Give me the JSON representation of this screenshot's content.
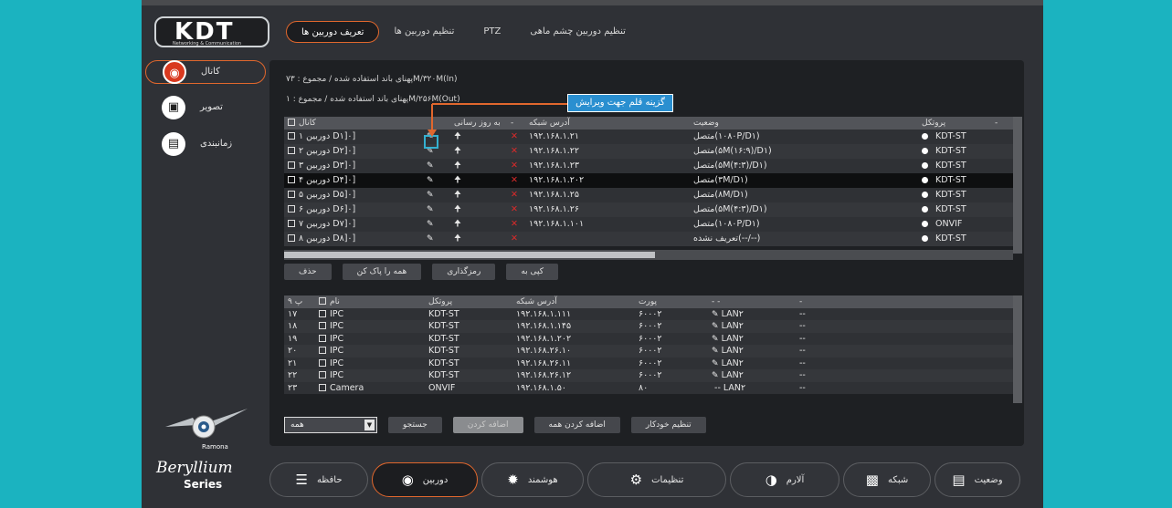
{
  "logo": {
    "title": "KDT",
    "subtitle": "Networking & Communication"
  },
  "tabs": [
    "تعریف دوربین ها",
    "تنظیم دوربین ها",
    "PTZ",
    "تنظیم دوربین چشم ماهی"
  ],
  "sidebar": [
    {
      "label": "کانال",
      "icon": "camera-icon"
    },
    {
      "label": "تصویر",
      "icon": "image-icon"
    },
    {
      "label": "زمانبندی",
      "icon": "calendar-icon"
    }
  ],
  "bandwidth": {
    "in": "پهنای باند استفاده شده / مجموع : ۷۳M/۳۲۰M(In)",
    "out": "پهنای باند استفاده شده / مجموع : ۱M/۲۵۶M(Out)"
  },
  "annotation": "گزینه قلم جهت ویرایش",
  "table1": {
    "headers": [
      "کانال",
      "",
      "به روز رسانی",
      "-",
      "آدرس شبکه",
      "وضعیت",
      "پروتکل",
      "-"
    ],
    "rows": [
      {
        "channel": "دوربین ۱ D۱]۰]",
        "ip": "۱۹۲.۱۶۸.۱.۲۱",
        "status": "متصل(۱۰۸۰P/D۱)",
        "protocol": "KDT-ST"
      },
      {
        "channel": "دوربین ۲ D۲]۰]",
        "ip": "۱۹۲.۱۶۸.۱.۲۲",
        "status": "متصل(۵M(۱۶:۹)/D۱)",
        "protocol": "KDT-ST"
      },
      {
        "channel": "دوربین ۳ D۳]۰]",
        "ip": "۱۹۲.۱۶۸.۱.۲۳",
        "status": "متصل(۵M(۴:۳)/D۱)",
        "protocol": "KDT-ST"
      },
      {
        "channel": "دوربین ۴ D۴]۰]",
        "ip": "۱۹۲.۱۶۸.۱.۲۰۲",
        "status": "متصل(۳M/D۱)",
        "protocol": "KDT-ST"
      },
      {
        "channel": "دوربین ۵ D۵]۰]",
        "ip": "۱۹۲.۱۶۸.۱.۲۵",
        "status": "متصل(۸M/D۱)",
        "protocol": "KDT-ST"
      },
      {
        "channel": "دوربین ۶ D۶]۰]",
        "ip": "۱۹۲.۱۶۸.۱.۲۶",
        "status": "متصل(۵M(۴:۳)/D۱)",
        "protocol": "KDT-ST"
      },
      {
        "channel": "دوربین ۷ D۷]۰]",
        "ip": "۱۹۲.۱۶۸.۱.۱۰۱",
        "status": "متصل(۱۰۸۰P/D۱)",
        "protocol": "ONVIF"
      },
      {
        "channel": "دوربین ۸ D۸]۰]",
        "ip": "",
        "status": "تعریف نشده(--/--)",
        "protocol": "KDT-ST"
      }
    ]
  },
  "actions1": [
    "حذف",
    "همه را پاک کن",
    "رمزگذاری",
    "کپی به"
  ],
  "table2": {
    "headers": [
      "پ ۹",
      "نام",
      "پروتکل",
      "آدرس شبکه",
      "پورت",
      "- -",
      "-"
    ],
    "rows": [
      {
        "no": "۱۷",
        "name": "IPC",
        "protocol": "KDT-ST",
        "ip": "۱۹۲.۱۶۸.۱.۱۱۱",
        "port": "۶۰۰۰۲",
        "lan": "LAN۲",
        "extra": "--"
      },
      {
        "no": "۱۸",
        "name": "IPC",
        "protocol": "KDT-ST",
        "ip": "۱۹۲.۱۶۸.۱.۱۴۵",
        "port": "۶۰۰۰۲",
        "lan": "LAN۲",
        "extra": "--"
      },
      {
        "no": "۱۹",
        "name": "IPC",
        "protocol": "KDT-ST",
        "ip": "۱۹۲.۱۶۸.۱.۲۰۲",
        "port": "۶۰۰۰۲",
        "lan": "LAN۲",
        "extra": "--"
      },
      {
        "no": "۲۰",
        "name": "IPC",
        "protocol": "KDT-ST",
        "ip": "۱۹۲.۱۶۸.۲۶.۱۰",
        "port": "۶۰۰۰۲",
        "lan": "LAN۲",
        "extra": "--"
      },
      {
        "no": "۲۱",
        "name": "IPC",
        "protocol": "KDT-ST",
        "ip": "۱۹۲.۱۶۸.۲۶.۱۱",
        "port": "۶۰۰۰۲",
        "lan": "LAN۲",
        "extra": "--"
      },
      {
        "no": "۲۲",
        "name": "IPC",
        "protocol": "KDT-ST",
        "ip": "۱۹۲.۱۶۸.۲۶.۱۲",
        "port": "۶۰۰۰۲",
        "lan": "LAN۲",
        "extra": "--"
      },
      {
        "no": "۲۳",
        "name": "Camera",
        "protocol": "ONVIF",
        "ip": "۱۹۲.۱۶۸.۱.۵۰",
        "port": "۸۰",
        "lan": "LAN۲",
        "extra": "--"
      }
    ]
  },
  "filter": {
    "selected": "همه"
  },
  "actions2": [
    "جستجو",
    "اضافه کردن",
    "اضافه کردن همه",
    "تنظیم خودکار"
  ],
  "brand": {
    "robot": "Ramona",
    "name": "Beryllium",
    "series": "Series"
  },
  "nav": [
    {
      "label": "حافظه",
      "icon": "storage-icon"
    },
    {
      "label": "دوربین",
      "icon": "camera-icon"
    },
    {
      "label": "هوشمند",
      "icon": "smart-icon"
    },
    {
      "label": "تنظیمات",
      "icon": "settings-icon"
    },
    {
      "label": "آلارم",
      "icon": "alarm-icon"
    },
    {
      "label": "شبکه",
      "icon": "network-icon"
    },
    {
      "label": "وضعیت",
      "icon": "status-icon"
    }
  ],
  "colors": {
    "accent": "#e0672d",
    "background": "#1bb3c0",
    "error": "#d92a2a"
  }
}
